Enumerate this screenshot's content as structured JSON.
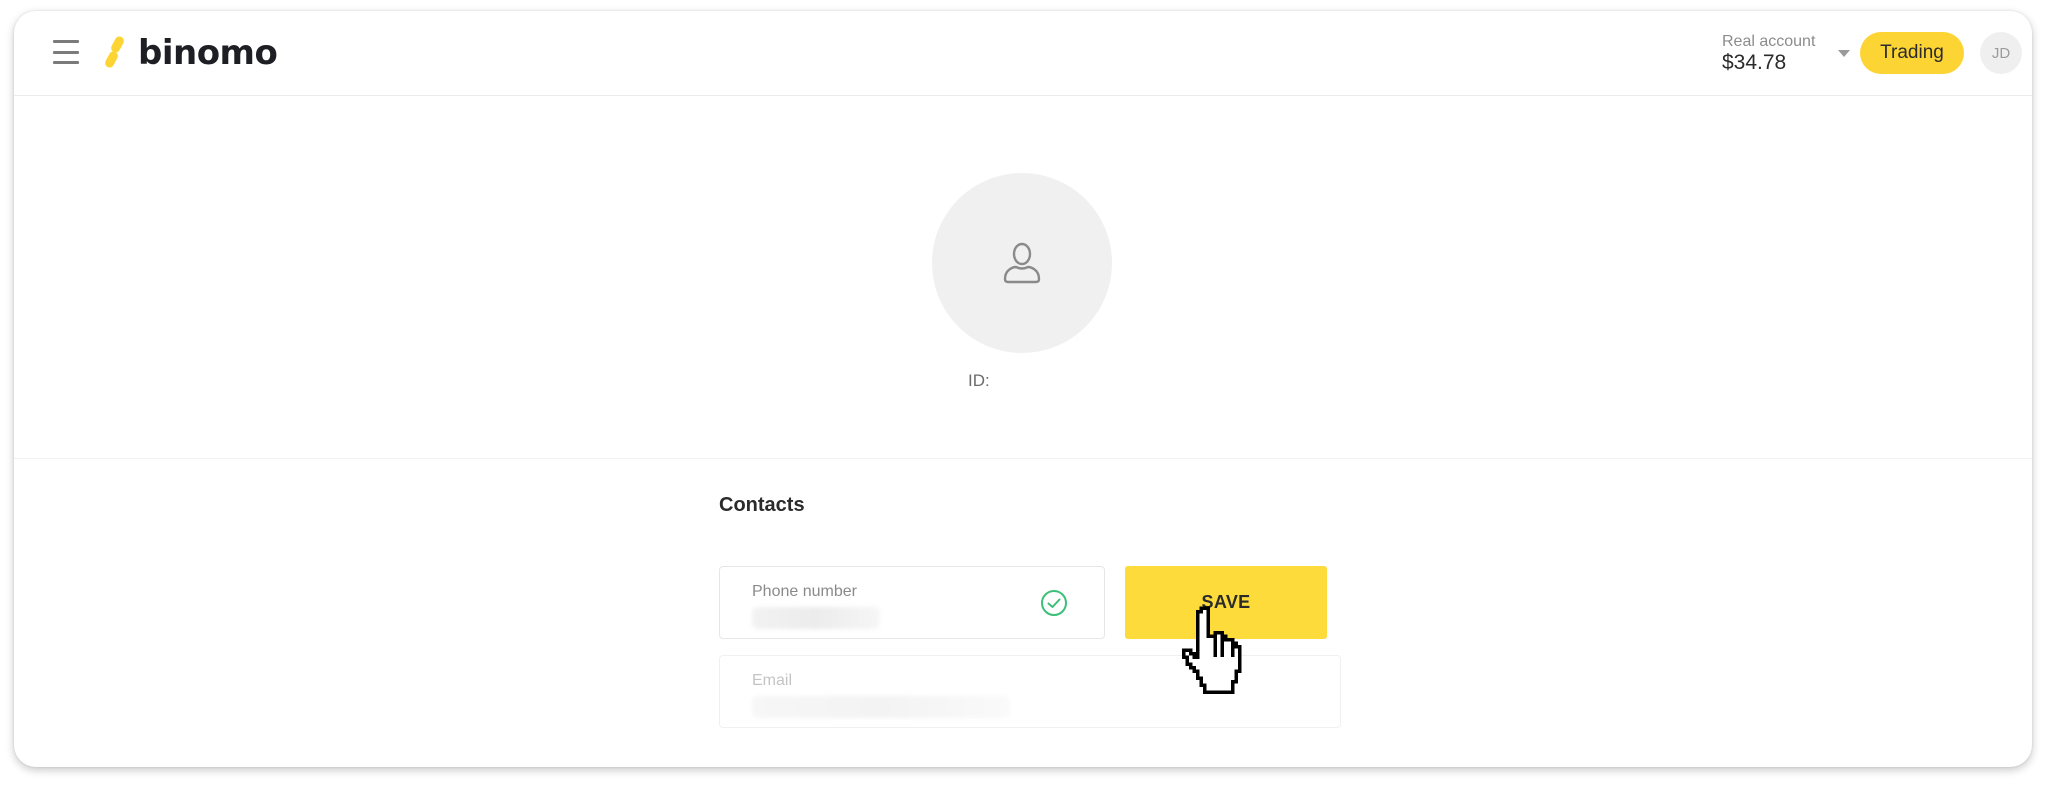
{
  "header": {
    "menu_icon": "hamburger-icon",
    "logo_text": "binomo",
    "account": {
      "label": "Real account",
      "balance": "$34.78",
      "dropdown_icon": "caret-down-icon"
    },
    "trading_button": "Trading",
    "user_initials": "JD"
  },
  "profile": {
    "avatar_icon": "user-icon",
    "id_label": "ID:"
  },
  "contacts": {
    "title": "Contacts",
    "phone": {
      "label": "Phone number",
      "value_hidden": true,
      "status_icon": "check-circle-icon"
    },
    "email": {
      "label": "Email",
      "value_hidden": true
    },
    "save_button": "SAVE"
  },
  "colors": {
    "brand_yellow": "#fcd535",
    "save_yellow": "#fddb3a",
    "success_green": "#3dbf7a",
    "text_dark": "#2b2b2b"
  }
}
